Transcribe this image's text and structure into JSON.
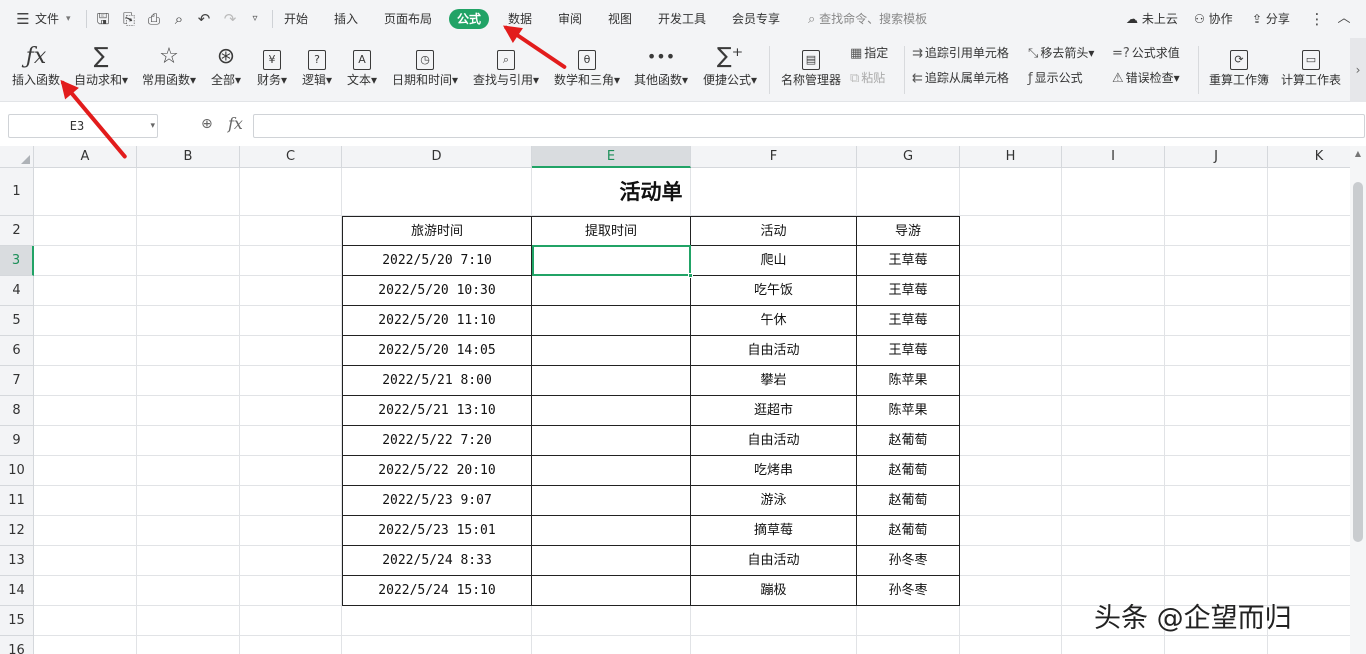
{
  "menubar": {
    "file_label": "文件",
    "tabs": [
      {
        "label": "开始",
        "active": false
      },
      {
        "label": "插入",
        "active": false
      },
      {
        "label": "页面布局",
        "active": false
      },
      {
        "label": "公式",
        "active": true
      },
      {
        "label": "数据",
        "active": false
      },
      {
        "label": "审阅",
        "active": false
      },
      {
        "label": "视图",
        "active": false
      },
      {
        "label": "开发工具",
        "active": false
      },
      {
        "label": "会员专享",
        "active": false
      }
    ],
    "search_placeholder": "查找命令、搜索模板",
    "cloud_label": "未上云",
    "collab_label": "协作",
    "share_label": "分享",
    "accent_color": "#21a366"
  },
  "ribbon": {
    "insert_function": "插入函数",
    "autosum": "自动求和",
    "common_functions": "常用函数",
    "all": "全部",
    "finance": "财务",
    "logic": "逻辑",
    "text": "文本",
    "datetime": "日期和时间",
    "lookup": "查找与引用",
    "math": "数学和三角",
    "other": "其他函数",
    "quick_formula": "便捷公式",
    "name_manager": "名称管理器",
    "assign": "指定",
    "paste": "粘贴",
    "trace_precedents": "追踪引用单元格",
    "trace_dependents": "追踪从属单元格",
    "remove_arrows": "移去箭头",
    "show_formula": "显示公式",
    "evaluate": "公式求值",
    "error_check": "错误检查",
    "recalc_workbook": "重算工作簿",
    "calc_sheet": "计算工作表"
  },
  "formula_bar": {
    "name_box": "E3",
    "fx": "fx",
    "value": ""
  },
  "sheet": {
    "columns": [
      "A",
      "B",
      "C",
      "D",
      "E",
      "F",
      "G",
      "H",
      "I",
      "J",
      "K"
    ],
    "rows": [
      "1",
      "2",
      "3",
      "4",
      "5",
      "6",
      "7",
      "8",
      "9",
      "10",
      "11",
      "12",
      "13",
      "14",
      "15",
      "16"
    ],
    "selected_column": "E",
    "selected_row": "3",
    "title": "活动单",
    "headers": [
      "旅游时间",
      "提取时间",
      "活动",
      "导游"
    ],
    "data": [
      [
        "2022/5/20  7:10",
        "",
        "爬山",
        "王草莓"
      ],
      [
        "2022/5/20  10:30",
        "",
        "吃午饭",
        "王草莓"
      ],
      [
        "2022/5/20  11:10",
        "",
        "午休",
        "王草莓"
      ],
      [
        "2022/5/20  14:05",
        "",
        "自由活动",
        "王草莓"
      ],
      [
        "2022/5/21  8:00",
        "",
        "攀岩",
        "陈苹果"
      ],
      [
        "2022/5/21  13:10",
        "",
        "逛超市",
        "陈苹果"
      ],
      [
        "2022/5/22  7:20",
        "",
        "自由活动",
        "赵葡萄"
      ],
      [
        "2022/5/22  20:10",
        "",
        "吃烤串",
        "赵葡萄"
      ],
      [
        "2022/5/23  9:07",
        "",
        "游泳",
        "赵葡萄"
      ],
      [
        "2022/5/23  15:01",
        "",
        "摘草莓",
        "赵葡萄"
      ],
      [
        "2022/5/24  8:33",
        "",
        "自由活动",
        "孙冬枣"
      ],
      [
        "2022/5/24  15:10",
        "",
        "蹦极",
        "孙冬枣"
      ]
    ]
  },
  "watermark": "头条 @企望而归"
}
